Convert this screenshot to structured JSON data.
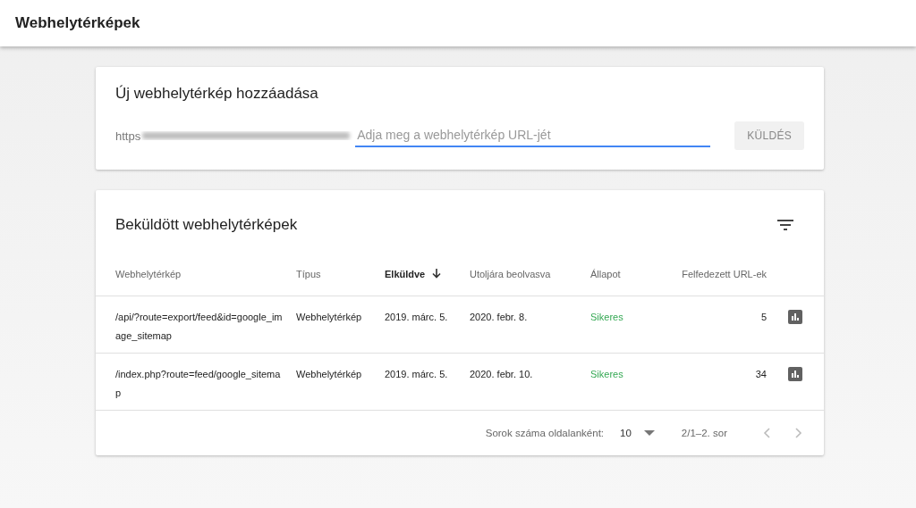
{
  "app_bar": {
    "title": "Webhelytérképek"
  },
  "add_card": {
    "title": "Új webhelytérkép hozzáadása",
    "url_prefix": "https",
    "placeholder": "Adja meg a webhelytérkép URL-jét",
    "button": "KÜLDÉS",
    "button_disabled": true
  },
  "submitted_card": {
    "title": "Beküldött webhelytérképek",
    "table": {
      "columns": [
        {
          "label": "Webhelytérkép",
          "sorted": false
        },
        {
          "label": "Típus",
          "sorted": false
        },
        {
          "label": "Elküldve",
          "sorted": true
        },
        {
          "label": "Utoljára beolvasva",
          "sorted": false
        },
        {
          "label": "Állapot",
          "sorted": false
        },
        {
          "label": "Felfedezett URL-ek",
          "sorted": false
        }
      ],
      "rows": [
        {
          "sitemap": "/api/?route=export/feed&id=google_image_sitemap",
          "type": "Webhelytérkép",
          "submitted": "2019. márc. 5.",
          "last_read": "2020. febr. 8.",
          "status": "Sikeres",
          "success": true,
          "urls": "5"
        },
        {
          "sitemap": "/index.php?route=feed/google_sitemap",
          "type": "Webhelytérkép",
          "submitted": "2019. márc. 5.",
          "last_read": "2020. febr. 10.",
          "status": "Sikeres",
          "success": true,
          "urls": "34"
        }
      ]
    },
    "pagination": {
      "rows_per_page_label": "Sorok száma oldalanként:",
      "rows_per_page": "10",
      "range": "2/1–2. sor"
    }
  }
}
